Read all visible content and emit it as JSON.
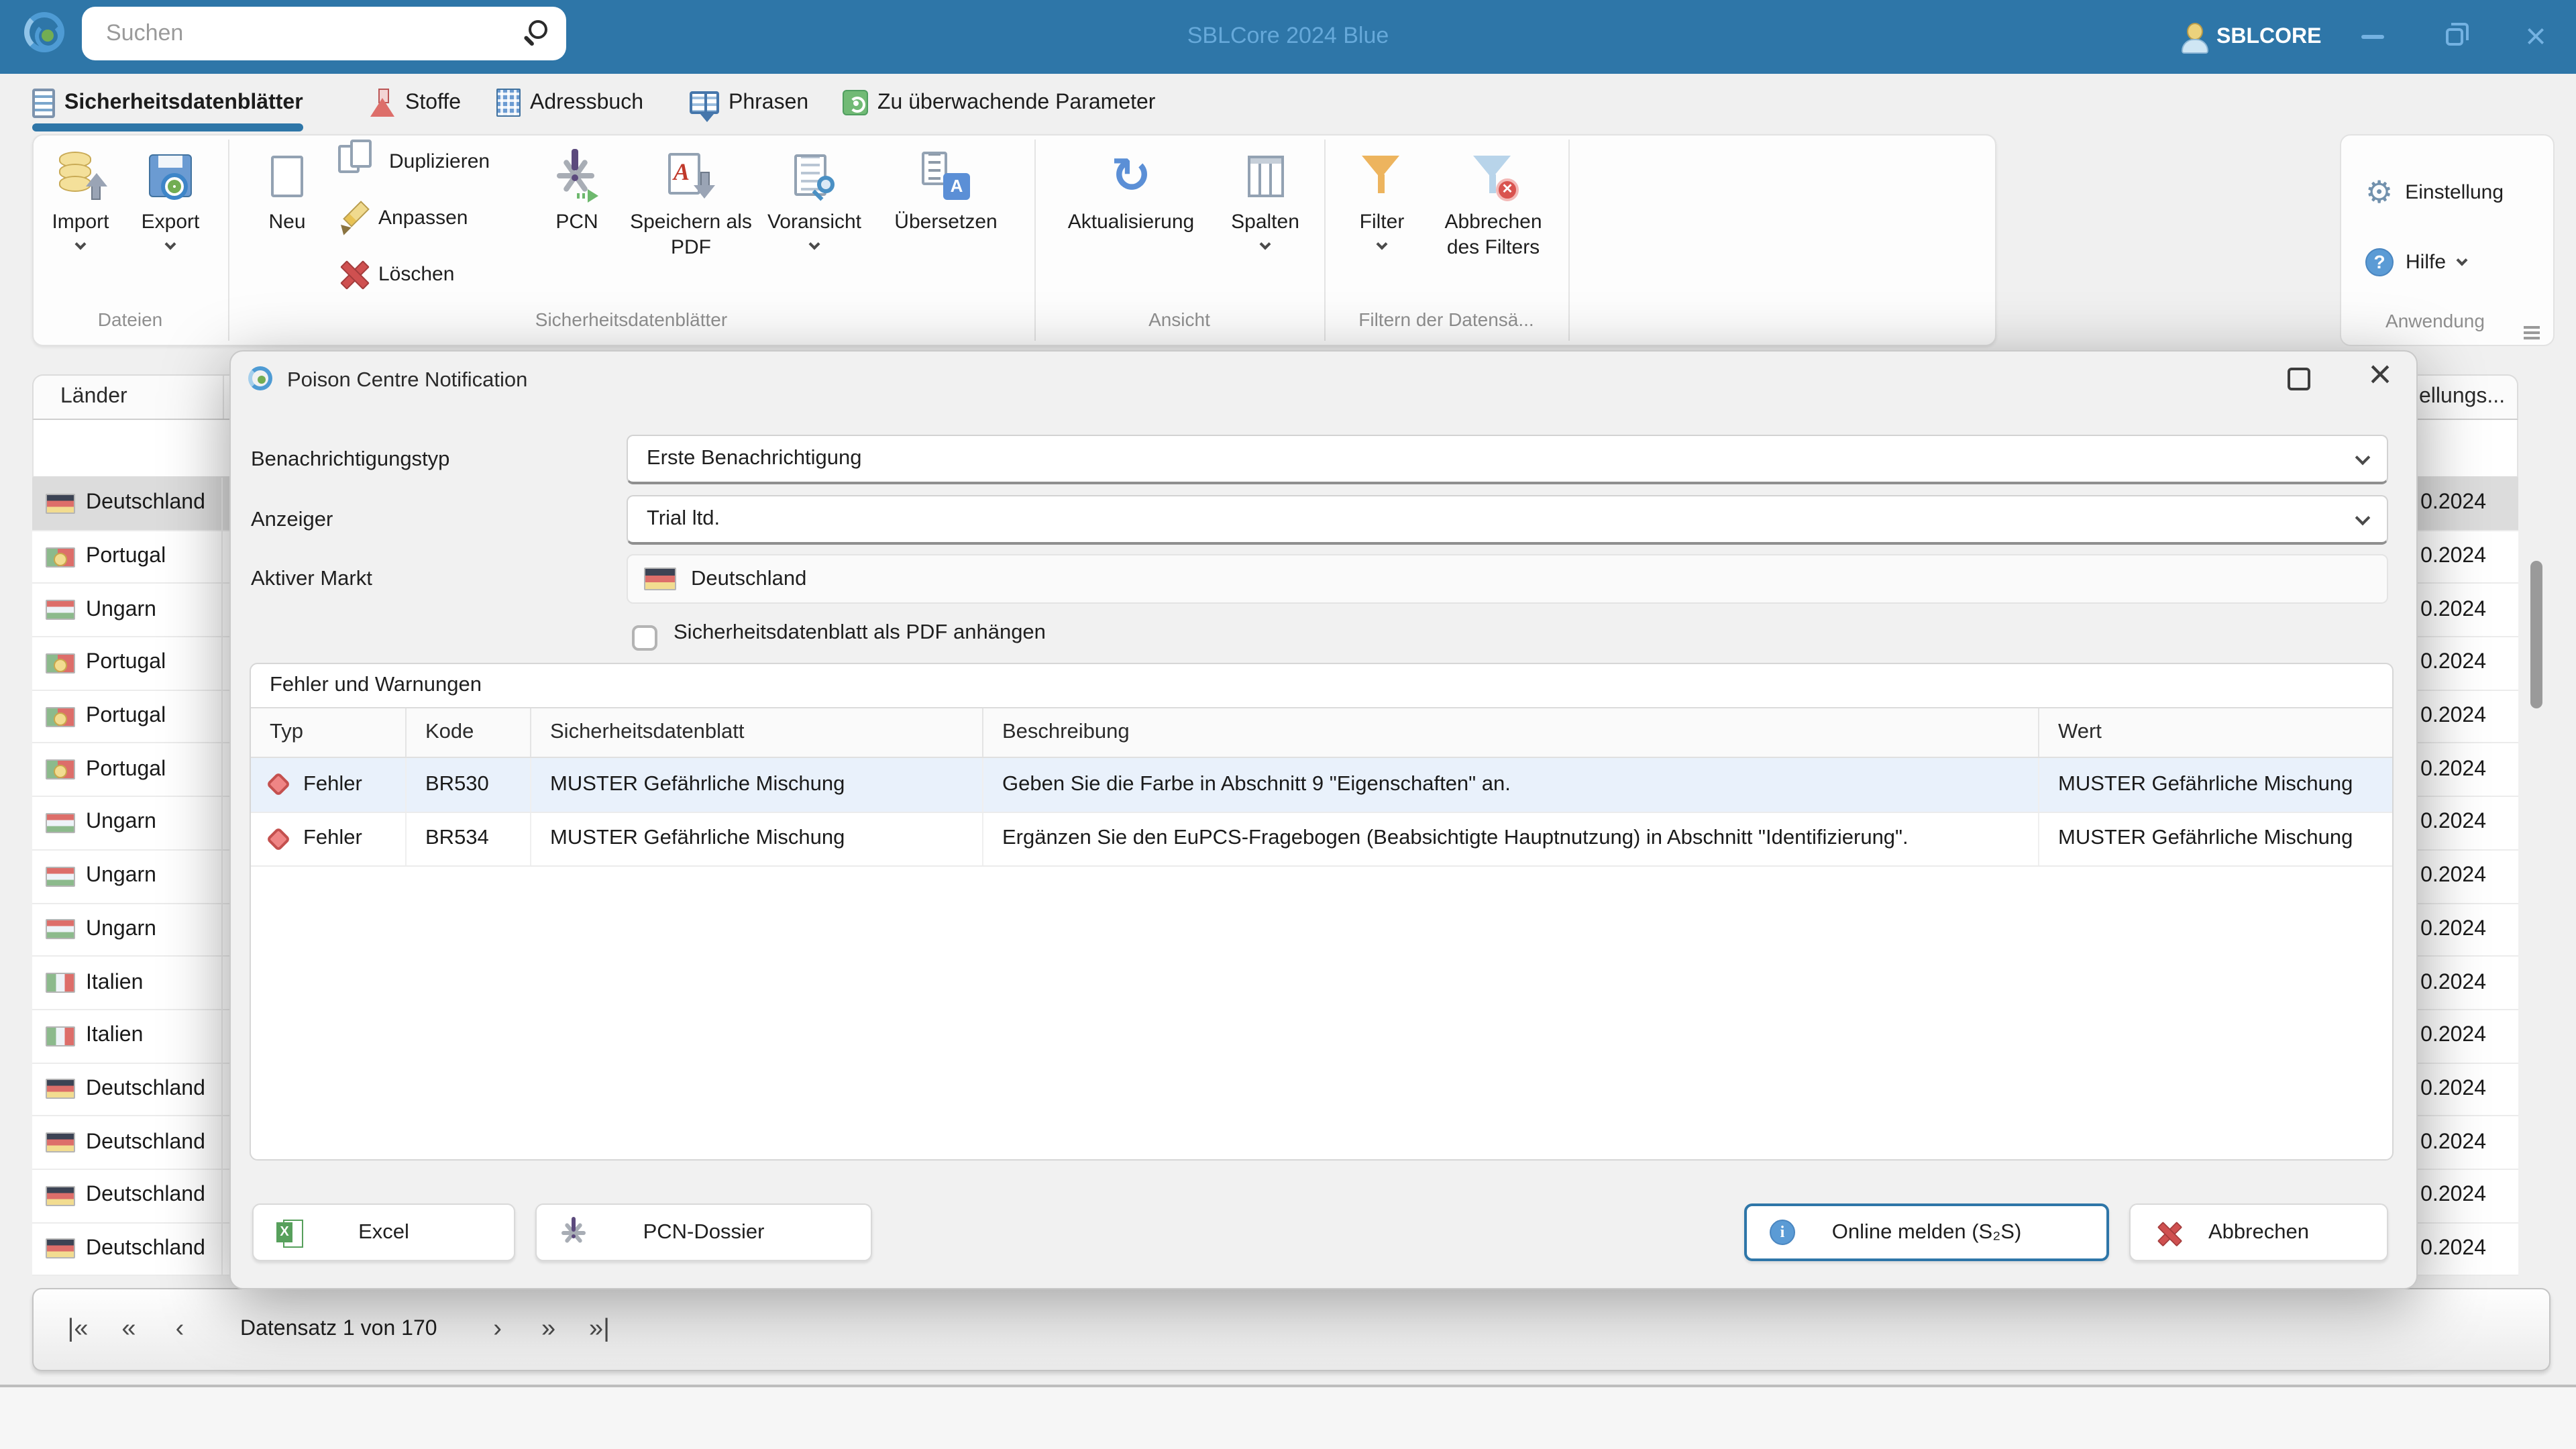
{
  "colors": {
    "titlebar": "#2e76a8",
    "accent": "#2e76a8",
    "app_title_text": "#66a9da",
    "selected_row_gray": "#dcdcdc",
    "selected_error_row": "#e9f1fb",
    "error_red": "#ef8585"
  },
  "titlebar": {
    "app_title": "SBLCore 2024 Blue",
    "account_label": "SBLCORE",
    "search_placeholder": "Suchen"
  },
  "tabs": [
    {
      "label": "Sicherheitsdatenblätter",
      "icon": "datasheet-icon",
      "active": true
    },
    {
      "label": "Stoffe",
      "icon": "flask-icon",
      "active": false
    },
    {
      "label": "Adressbuch",
      "icon": "building-icon",
      "active": false
    },
    {
      "label": "Phrasen",
      "icon": "book-icon",
      "active": false
    },
    {
      "label": "Zu überwachende Parameter",
      "icon": "parameter-icon",
      "active": false
    }
  ],
  "ribbon": {
    "group_labels": {
      "dateien": "Dateien",
      "sicherheitsdatenblaetter": "Sicherheitsdatenblätter",
      "ansicht": "Ansicht",
      "filtern": "Filtern der Datensä...",
      "anwendung": "Anwendung"
    },
    "buttons": {
      "import": "Import",
      "export": "Export",
      "neu": "Neu",
      "duplizieren": "Duplizieren",
      "anpassen": "Anpassen",
      "loeschen": "Löschen",
      "pcn": "PCN",
      "speichern_als_pdf": "Speichern als PDF",
      "voransicht": "Voransicht",
      "uebersetzen": "Übersetzen",
      "aktualisierung": "Aktualisierung",
      "spalten": "Spalten",
      "filter": "Filter",
      "abbrechen_des_filters": "Abbrechen des Filters",
      "einstellung": "Einstellung",
      "hilfe": "Hilfe"
    }
  },
  "main_table": {
    "country_column_header": "Länder",
    "date_column_header_visible": "ellungs...",
    "rows": [
      {
        "country": "Deutschland",
        "flag": "de",
        "date": "0.2024",
        "selected": true
      },
      {
        "country": "Portugal",
        "flag": "pt",
        "date": "0.2024",
        "selected": false
      },
      {
        "country": "Ungarn",
        "flag": "hu",
        "date": "0.2024",
        "selected": false
      },
      {
        "country": "Portugal",
        "flag": "pt",
        "date": "0.2024",
        "selected": false
      },
      {
        "country": "Portugal",
        "flag": "pt",
        "date": "0.2024",
        "selected": false
      },
      {
        "country": "Portugal",
        "flag": "pt",
        "date": "0.2024",
        "selected": false
      },
      {
        "country": "Ungarn",
        "flag": "hu",
        "date": "0.2024",
        "selected": false
      },
      {
        "country": "Ungarn",
        "flag": "hu",
        "date": "0.2024",
        "selected": false
      },
      {
        "country": "Ungarn",
        "flag": "hu",
        "date": "0.2024",
        "selected": false
      },
      {
        "country": "Italien",
        "flag": "it",
        "date": "0.2024",
        "selected": false
      },
      {
        "country": "Italien",
        "flag": "it",
        "date": "0.2024",
        "selected": false
      },
      {
        "country": "Deutschland",
        "flag": "de",
        "date": "0.2024",
        "selected": false
      },
      {
        "country": "Deutschland",
        "flag": "de",
        "date": "0.2024",
        "selected": false
      },
      {
        "country": "Deutschland",
        "flag": "de",
        "date": "0.2024",
        "selected": false
      },
      {
        "country": "Deutschland",
        "flag": "de",
        "date": "0.2024",
        "selected": false
      }
    ]
  },
  "pagination": {
    "record_text": "Datensatz 1 von 170"
  },
  "dialog": {
    "title": "Poison Centre Notification",
    "fields": {
      "benachrichtigungstyp": {
        "label": "Benachrichtigungstyp",
        "value": "Erste Benachrichtigung"
      },
      "anzeiger": {
        "label": "Anzeiger",
        "value": "Trial ltd."
      },
      "aktiver_markt": {
        "label": "Aktiver Markt",
        "value": "Deutschland"
      }
    },
    "checkbox_label": "Sicherheitsdatenblatt als PDF anhängen",
    "panel_title": "Fehler und Warnungen",
    "table": {
      "headers": [
        "Typ",
        "Kode",
        "Sicherheitsdatenblatt",
        "Beschreibung",
        "Wert"
      ],
      "rows": [
        {
          "typ": "Fehler",
          "kode": "BR530",
          "sdb": "MUSTER Gefährliche Mischung",
          "beschreibung": "Geben Sie die Farbe in Abschnitt 9 \"Eigenschaften\" an.",
          "wert": "MUSTER Gefährliche Mischung",
          "selected": true
        },
        {
          "typ": "Fehler",
          "kode": "BR534",
          "sdb": "MUSTER Gefährliche Mischung",
          "beschreibung": "Ergänzen Sie den EuPCS-Fragebogen (Beabsichtigte Hauptnutzung) in Abschnitt \"Identifizierung\".",
          "wert": "MUSTER Gefährliche Mischung",
          "selected": false
        }
      ]
    },
    "buttons": {
      "excel": "Excel",
      "pcn_dossier": "PCN-Dossier",
      "online": "Online melden (S₂S)",
      "cancel": "Abbrechen"
    }
  }
}
